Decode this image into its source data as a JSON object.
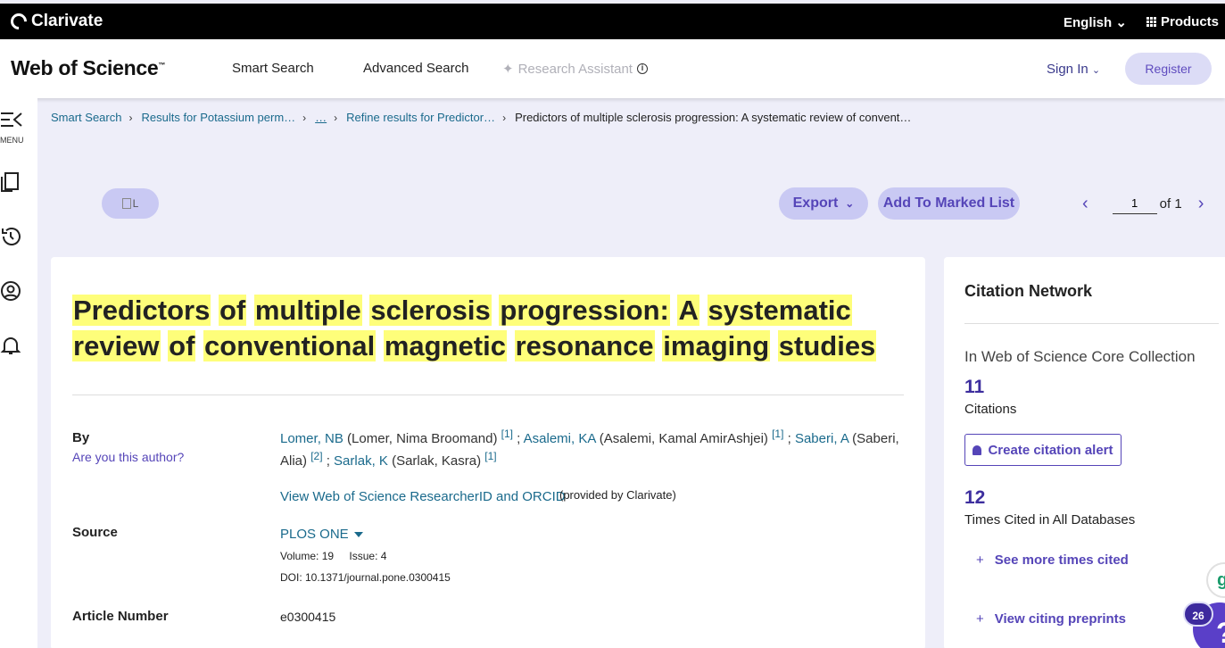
{
  "topbar": {
    "logo": "Clarivate",
    "language": "English",
    "products": "Products"
  },
  "nav": {
    "brand": "Web of Science",
    "brand_tm": "™",
    "smart_search": "Smart Search",
    "advanced_search": "Advanced Search",
    "research_assistant": "Research Assistant",
    "sign_in": "Sign In",
    "register": "Register"
  },
  "rail": {
    "menu_label": "MENU"
  },
  "breadcrumb": [
    "Smart Search",
    "Results for Potassium perm…",
    "…",
    "Refine results for Predictor…",
    "Predictors of multiple sclerosis progression: A systematic review of convent…"
  ],
  "actions": {
    "image_alt": "L",
    "export": "Export",
    "add_marked": "Add To Marked List",
    "page_value": "1",
    "page_of": "of 1"
  },
  "record": {
    "title_words": [
      "Predictors",
      "of",
      "multiple",
      "sclerosis",
      "progression:",
      "A",
      "systematic",
      "review",
      "of",
      "conventional",
      "magnetic",
      "resonance",
      "imaging",
      "studies"
    ],
    "by_label": "By",
    "author_question": "Are you this author?",
    "authors": [
      {
        "short": "Lomer, NB",
        "full": "(Lomer, Nima Broomand)",
        "ref": "[1]",
        "sep": " ;"
      },
      {
        "short": "Asalemi, KA",
        "full": "(Asalemi, Kamal AmirAshjei)",
        "ref": "[1]",
        "sep": " ;"
      },
      {
        "short": "Saberi, A",
        "full": "(Saberi, Alia)",
        "ref": "[2]",
        "sep": " ;"
      },
      {
        "short": "Sarlak, K",
        "full": "(Sarlak, Kasra)",
        "ref": "[1]",
        "sep": ""
      }
    ],
    "researcher_link": "View Web of Science ResearcherID and ORCID",
    "researcher_note": "(provided by Clarivate)",
    "source_label": "Source",
    "journal": "PLOS ONE",
    "volume": "Volume: 19",
    "issue": "Issue: 4",
    "doi": "DOI: 10.1371/journal.pone.0300415",
    "article_number_label": "Article Number",
    "article_number": "e0300415"
  },
  "citation": {
    "title": "Citation Network",
    "collection": "In Web of Science Core Collection",
    "citations_count": "11",
    "citations_label": "Citations",
    "alert_button": "Create citation alert",
    "times_cited_count": "12",
    "times_cited_label": "Times Cited in All Databases",
    "see_more": "See more times cited",
    "view_preprints": "View citing preprints"
  },
  "floating": {
    "badge": "26",
    "help": "?",
    "g": "g"
  },
  "colors": {
    "accent": "#5545b8",
    "link": "#1a6a8c",
    "highlight": "#fefe7a",
    "page_bg": "#eeeef9"
  }
}
